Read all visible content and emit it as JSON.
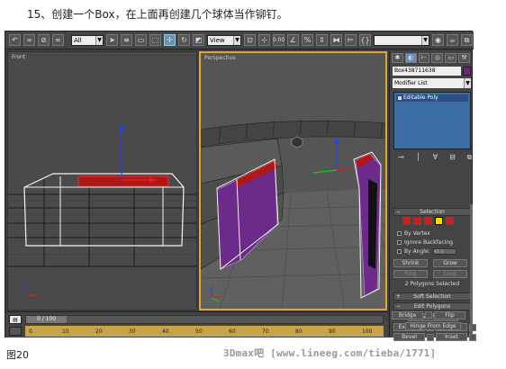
{
  "caption_top": "15、创建一个Box，在上面再创建几个球体当作铆钉。",
  "caption_bottom": "图20",
  "watermark": "3Dmax吧 [www.lineeg.com/tieba/1771]",
  "toolbar": {
    "selection_filter": "All",
    "reference_coord": "View",
    "extra_value": "0.00"
  },
  "viewports": {
    "front_label": "Front",
    "perspective_label": "Perspective"
  },
  "command_panel": {
    "object_name": "Box438711638",
    "object_color": "#7a1a8c",
    "modifier_list": "Modifier List",
    "stack_item": "Editable Poly",
    "selection_header": "Selection",
    "by_vertex": "By Vertex",
    "ignore_backfacing": "Ignore Backfacing",
    "by_angle": "By Angle:",
    "by_angle_value": "45.0",
    "shrink": "Shrink",
    "grow": "Grow",
    "ring": "Ring",
    "loop": "Loop",
    "selection_info": "2 Polygons Selected",
    "soft_selection_header": "Soft Selection",
    "edit_polygons_header": "Edit Polygons",
    "insert_vertex": "Insert Vertex",
    "extrude": "Extrude",
    "outline": "Outline",
    "bevel": "Bevel",
    "inset": "Inset",
    "bridge": "Bridge",
    "flip": "Flip",
    "hinge_from_edge": "Hinge From Edge"
  },
  "timeline": {
    "frame_label": "0 / 100",
    "ticks": [
      "0",
      "10",
      "20",
      "30",
      "40",
      "50",
      "60",
      "70",
      "80",
      "90",
      "100"
    ]
  },
  "colors": {
    "selection_red": "#c62020",
    "viewport_active_border": "#e3a62f",
    "object_purple": "#6c2a8a"
  }
}
